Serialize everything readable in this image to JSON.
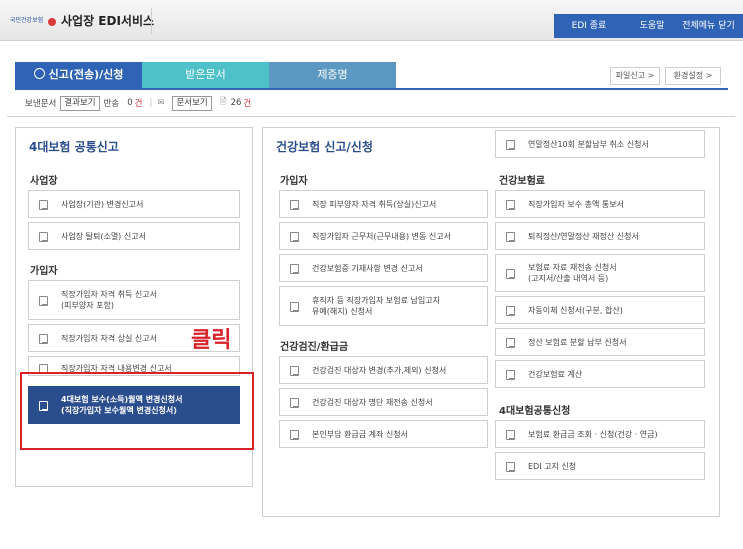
{
  "header": {
    "logo_text": "국민건강보험",
    "title": "사업장 EDI서비스",
    "edi_end": "EDI 종료",
    "help": "도움말",
    "close_all": "전체메뉴 닫기"
  },
  "tabs": [
    {
      "label": "신고(전송)/신청"
    },
    {
      "label": "받은문서"
    },
    {
      "label": "제증명"
    }
  ],
  "right_buttons": {
    "file_report": "파일신고 >",
    "env_settings": "환경설정 >"
  },
  "toolbar": {
    "sent_docs": "보낸문서",
    "result_view": "결과보기",
    "returned": "반송",
    "returned_count": "0",
    "unit1": "건",
    "doc_view": "문서보기",
    "doc_count": "26",
    "unit2": "건"
  },
  "left_panel": {
    "title": "4대보험 공통신고",
    "sections": {
      "workplace": "사업장",
      "join": "가입자"
    },
    "items": [
      "사업장(기관) 변경신고서",
      "사업장 탈퇴(소멸) 신고서",
      "직장가입자 자격 취득 신고서\n(피부양자 포함)",
      "직장가입자 자격 상실 신고서",
      "직장가입자 자격 내용변경 신고서",
      "4대보험 보수(소득)월액 변경신청서\n(직장가입자 보수월액 변경신청서)"
    ]
  },
  "annotation": {
    "click": "클릭"
  },
  "right_panel": {
    "title": "건강보험 신고/신청",
    "top_item": "연말정산10회 분할납부 취소 신청서",
    "sections": {
      "join": "가입자",
      "premium": "건강보험료",
      "checkup": "건강검진/환급금",
      "common": "4대보험공통신청"
    },
    "join_items": [
      "직장 피부양자 자격 취득(상실)신고서",
      "직장가입자 근무처(근무내용) 변동 신고서",
      "건강보험증 기재사항 변경 신고서",
      "휴직자 등 직장가입자 보험료 납입고지\n유예(해지) 신청서"
    ],
    "checkup_items": [
      "건강검진 대상자 변경(추가,제외) 신청서",
      "건강검진 대상자 명단 재전송 신청서",
      "본인부담 환급금 계좌 신청서"
    ],
    "premium_items": [
      "직장가입자 보수 총액 통보서",
      "퇴직정산/연말정산 재정산 신청서",
      "보험료 자료 재전송 신청서\n(고지서/산출 내역서 등)",
      "자동이체 신청서(구분, 합산)",
      "정산 보험료 분할 납부 신청서",
      "건강보험료 계산"
    ],
    "common_items": [
      "보험료 환급금 조회 · 신청(건강 · 연금)",
      "EDI 고지 신청"
    ]
  }
}
